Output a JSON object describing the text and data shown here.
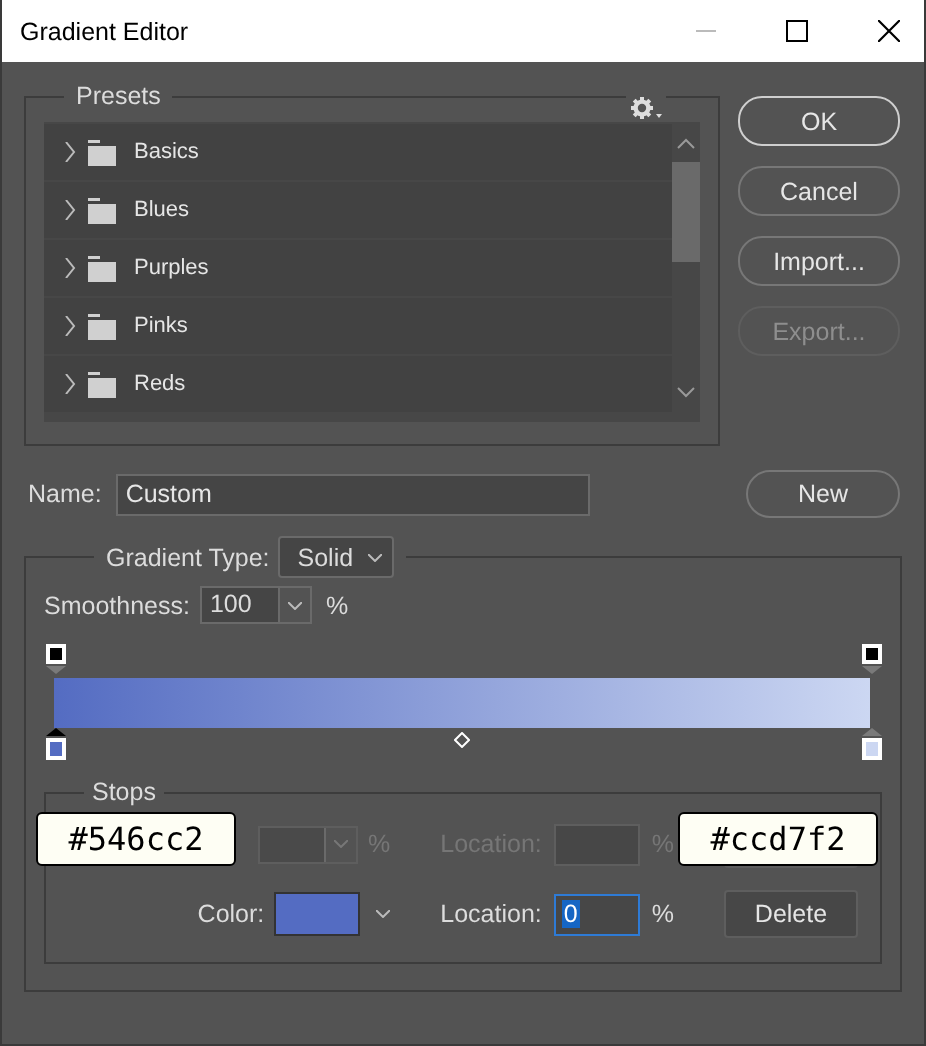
{
  "window": {
    "title": "Gradient Editor"
  },
  "presets": {
    "title": "Presets",
    "items": [
      {
        "label": "Basics",
        "expanded": false
      },
      {
        "label": "Blues",
        "expanded": false
      },
      {
        "label": "Purples",
        "expanded": false
      },
      {
        "label": "Pinks",
        "expanded": false
      },
      {
        "label": "Reds",
        "expanded": false
      }
    ]
  },
  "buttons": [
    {
      "label": "OK",
      "kind": "default",
      "disabled": false
    },
    {
      "label": "Cancel",
      "kind": "normal",
      "disabled": false
    },
    {
      "label": "Import...",
      "kind": "normal",
      "disabled": false
    },
    {
      "label": "Export...",
      "kind": "normal",
      "disabled": true
    }
  ],
  "name": {
    "label": "Name:",
    "value": "Custom",
    "button": "New"
  },
  "gradient": {
    "type_label": "Gradient Type:",
    "type": "Solid",
    "smoothness_label": "Smoothness:",
    "smoothness": "100",
    "smoothness_unit": "%",
    "opacity_stops": [
      {
        "selected": false
      },
      {
        "selected": false
      }
    ],
    "color_stops": [
      {
        "color": "#546cc2",
        "selected": true
      },
      {
        "color": "#ccd7f2",
        "selected": false
      }
    ],
    "stops": {
      "title": "Stops",
      "opacity_row": {
        "unit": "%",
        "location_label": "Location:",
        "location_unit": "%",
        "disabled": true
      },
      "color_row": {
        "label": "Color:",
        "color": "#546cc2",
        "location_label": "Location:",
        "location": "0",
        "location_unit": "%",
        "delete": "Delete",
        "disabled": false
      }
    }
  },
  "tooltips": [
    {
      "text": "#546cc2"
    },
    {
      "text": "#ccd7f2"
    }
  ]
}
